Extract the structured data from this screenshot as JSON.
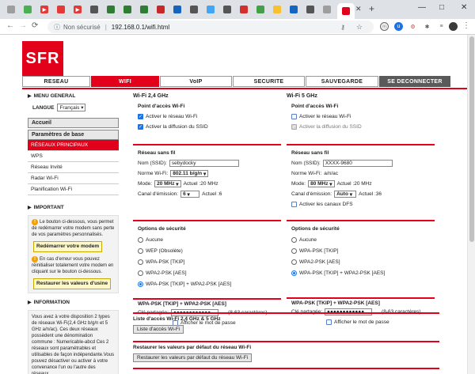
{
  "browser": {
    "tab_close": "✕",
    "new_tab": "+",
    "window_controls": [
      "—",
      "□",
      "✕"
    ],
    "security_label": "Non sécurisé",
    "url": "192.168.0.1/wifi.html",
    "tabs": [
      {
        "icon": "page-icon",
        "color": "#9e9e9e",
        "glyph": ""
      },
      {
        "icon": "folder-icon",
        "color": "#4caf50",
        "glyph": ""
      },
      {
        "icon": "youtube-icon",
        "color": "#e53935",
        "glyph": "▶"
      },
      {
        "icon": "media-icon",
        "color": "#e53935",
        "glyph": ""
      },
      {
        "icon": "youtube-icon",
        "color": "#e53935",
        "glyph": "▶"
      },
      {
        "icon": "gun-icon",
        "color": "#555",
        "glyph": ""
      },
      {
        "icon": "green-icon",
        "color": "#2e7d32",
        "glyph": ""
      },
      {
        "icon": "green-icon",
        "color": "#2e7d32",
        "glyph": ""
      },
      {
        "icon": "green-icon",
        "color": "#2e7d32",
        "glyph": ""
      },
      {
        "icon": "red-icon",
        "color": "#c62828",
        "glyph": ""
      },
      {
        "icon": "news-icon",
        "color": "#1565c0",
        "glyph": ""
      },
      {
        "icon": "gun-icon",
        "color": "#555",
        "glyph": ""
      },
      {
        "icon": "cloud-icon",
        "color": "#42a5f5",
        "glyph": ""
      },
      {
        "icon": "gun-icon",
        "color": "#555",
        "glyph": ""
      },
      {
        "icon": "shield-icon",
        "color": "#d32f2f",
        "glyph": ""
      },
      {
        "icon": "check-icon",
        "color": "#43a047",
        "glyph": ""
      },
      {
        "icon": "yellow-icon",
        "color": "#fbc02d",
        "glyph": ""
      },
      {
        "icon": "chart-icon",
        "color": "#1565c0",
        "glyph": ""
      },
      {
        "icon": "gun-icon",
        "color": "#555",
        "glyph": ""
      },
      {
        "icon": "page-icon",
        "color": "#9e9e9e",
        "glyph": ""
      },
      {
        "icon": "sfr-icon",
        "color": "#e2001a",
        "glyph": ""
      }
    ]
  },
  "brand": {
    "logo": "SFR",
    "accent": "#e2001a"
  },
  "nav": [
    {
      "label": "RESEAU",
      "state": "normal"
    },
    {
      "label": "WIFI",
      "state": "active"
    },
    {
      "label": "VoIP",
      "state": "normal"
    },
    {
      "label": "SECURITE",
      "state": "normal"
    },
    {
      "label": "SAUVEGARDE",
      "state": "normal"
    },
    {
      "label": "SE DECONNECTER",
      "state": "dark"
    }
  ],
  "sidebar": {
    "menu_title": "MENU GENERAL",
    "lang_label": "LANGUE",
    "lang_value": "Français",
    "accueil": "Accueil",
    "params": "Paramètres de base",
    "items": [
      {
        "label": "RÉSEAUX PRINCIPAUX",
        "active": true
      },
      {
        "label": "WPS",
        "active": false
      },
      {
        "label": "Réseau Invité",
        "active": false
      },
      {
        "label": "Radar Wi-Fi",
        "active": false
      },
      {
        "label": "Planification Wi-Fi",
        "active": false
      }
    ],
    "important_title": "IMPORTANT",
    "important_text1": "Le bouton ci-dessous, vous permet de redémarrer votre modem sans perte de vos paramètres personnalisés.",
    "restart_btn": "Redémarrer votre modem",
    "important_text2": "En cas d'erreur vous pouvez réinitialiser totalement votre modem en cliquant sur le bouton ci-dessous.",
    "restore_btn": "Restaurer les valeurs d'usine",
    "info_title": "INFORMATION",
    "info_text": "Vous avez à votre disposition 2 types de réseaux Wi-Fi(2,4 GHz b/g/n et 5 GHz a/n/ac). Ces deux réseaux possèdent une dénomination commune : Numericable-abcd Ces 2 réseaux sont paramétrables et utilisables de façon indépendante.Vous pouvez désactiver ou activer à votre convenance l'un ou l'autre des réseaux."
  },
  "wifi24": {
    "title": "Wi-Fi 2,4 GHz",
    "ap_head": "Point d'accès Wi-Fi",
    "enable_label": "Activer le réseau Wi-Fi",
    "ssid_broadcast_label": "Activer la diffusion du SSID",
    "net_head": "Réseau sans fil",
    "ssid_label": "Nom (SSID):",
    "ssid_value": "sebydocky",
    "norm_label": "Norme Wi-Fi:",
    "norm_value": "802.11 b/g/n",
    "mode_label": "Mode:",
    "mode_value": "20 MHz",
    "mode_actual": "Actuel :20 MHz",
    "chan_label": "Canal d'émission:",
    "chan_value": "6",
    "chan_actual": "Actuel :6",
    "sec_head": "Options de sécurité",
    "sec_options": [
      {
        "label": "Aucune",
        "on": false
      },
      {
        "label": "WEP (Obsolète)",
        "on": false
      },
      {
        "label": "WPA-PSK [TKIP]",
        "on": false
      },
      {
        "label": "WPA2-PSK [AES]",
        "on": false
      },
      {
        "label": "WPA-PSK [TKIP] + WPA2-PSK [AES]",
        "on": true
      }
    ],
    "wpa_head": "WPA-PSK [TKIP] + WPA2-PSK [AES]",
    "key_label": "Clé partagée:",
    "key_value": "●●●●●●●●●●●●",
    "key_hint": "(8-63 caractères)",
    "show_pwd": "Afficher le mot de passe"
  },
  "wifi5": {
    "title": "Wi-Fi 5 GHz",
    "ap_head": "Point d'accès Wi-Fi",
    "enable_label": "Activer le réseau Wi-Fi",
    "ssid_broadcast_label": "Activer la diffusion du SSID",
    "net_head": "Réseau sans fil",
    "ssid_label": "Nom (SSID):",
    "ssid_value": "XXXX-9680",
    "norm_label": "Norme Wi-Fi:",
    "norm_value": "a/n/ac",
    "mode_label": "Mode:",
    "mode_value": "80 MHz",
    "mode_actual": "Actuel :20 MHz",
    "chan_label": "Canal d'émission:",
    "chan_value": "Auto",
    "chan_actual": "Actuel :36",
    "dfs_label": "Activer les canaux DFS",
    "sec_head": "Options de sécurité",
    "sec_options": [
      {
        "label": "Aucune",
        "on": false
      },
      {
        "label": "WPA-PSK [TKIP]",
        "on": false
      },
      {
        "label": "WPA2-PSK [AES]",
        "on": false
      },
      {
        "label": "WPA-PSK [TKIP] + WPA2-PSK [AES]",
        "on": true
      }
    ],
    "wpa_head": "WPA-PSK [TKIP] + WPA2-PSK [AES]",
    "key_label": "Clé partagée:",
    "key_value": "●●●●●●●●●●●●",
    "key_hint": "(8-63 caractères)",
    "show_pwd": "Afficher le mot de passe"
  },
  "access_list": {
    "head": "Liste d'accès Wi-Fi 2,4 GHz & 5 GHz",
    "btn": "Liste d'accès Wi-Fi"
  },
  "restore": {
    "head": "Restaurer les valeurs par défaut du réseau Wi-Fi",
    "btn": "Restaurer les valeurs par défaut du réseau Wi-Fi"
  }
}
